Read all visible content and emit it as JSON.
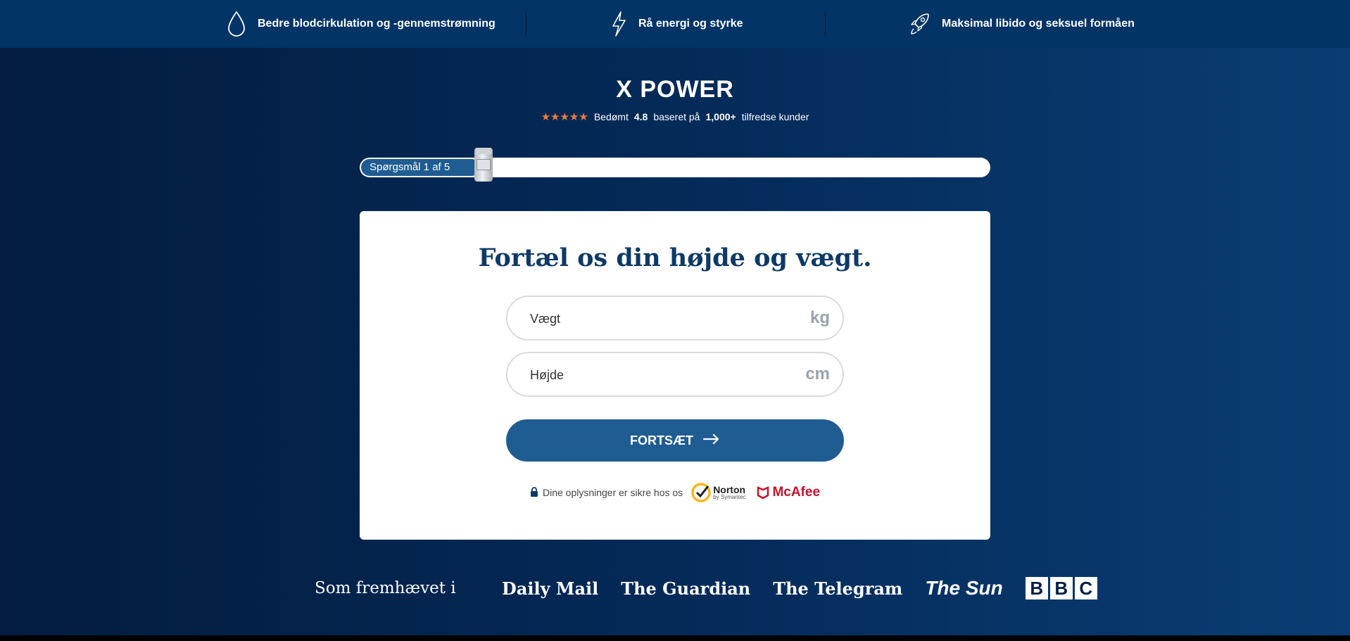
{
  "topbar": {
    "benefits": [
      {
        "icon": "drop-icon",
        "text": "Bedre blodcirkulation og -gennemstrømning"
      },
      {
        "icon": "lightning-icon",
        "text": "Rå energi og styrke"
      },
      {
        "icon": "rocket-icon",
        "text": "Maksimal libido og seksuel formåen"
      }
    ]
  },
  "brand": {
    "name": "X POWER"
  },
  "rating": {
    "prefix": "Bedømt",
    "score": "4.8",
    "middle": "baseret på",
    "count": "1,000+",
    "suffix": "tilfredse kunder",
    "stars": "★★★★★"
  },
  "progress": {
    "label": "Spørgsmål 1 af 5",
    "fraction": 0.2
  },
  "card": {
    "title": "Fortæl os din højde og vægt.",
    "weight": {
      "placeholder": "Vægt",
      "unit": "kg",
      "value": ""
    },
    "height": {
      "placeholder": "Højde",
      "unit": "cm",
      "value": ""
    },
    "continue_label": "FORTSÆT",
    "secure_text": "Dine oplysninger er sikre hos os",
    "norton": {
      "name": "Norton",
      "sub": "by Symantec"
    },
    "mcafee": {
      "name": "McAfee"
    }
  },
  "featured": {
    "label": "Som fremhævet i",
    "outlets": [
      "Daily Mail",
      "The Guardian",
      "The Telegram",
      "The Sun",
      "BBC"
    ]
  },
  "colors": {
    "accent": "#1f5c92",
    "topbar": "#023466",
    "star": "#ee7d3a",
    "mcafee": "#c8102e"
  }
}
